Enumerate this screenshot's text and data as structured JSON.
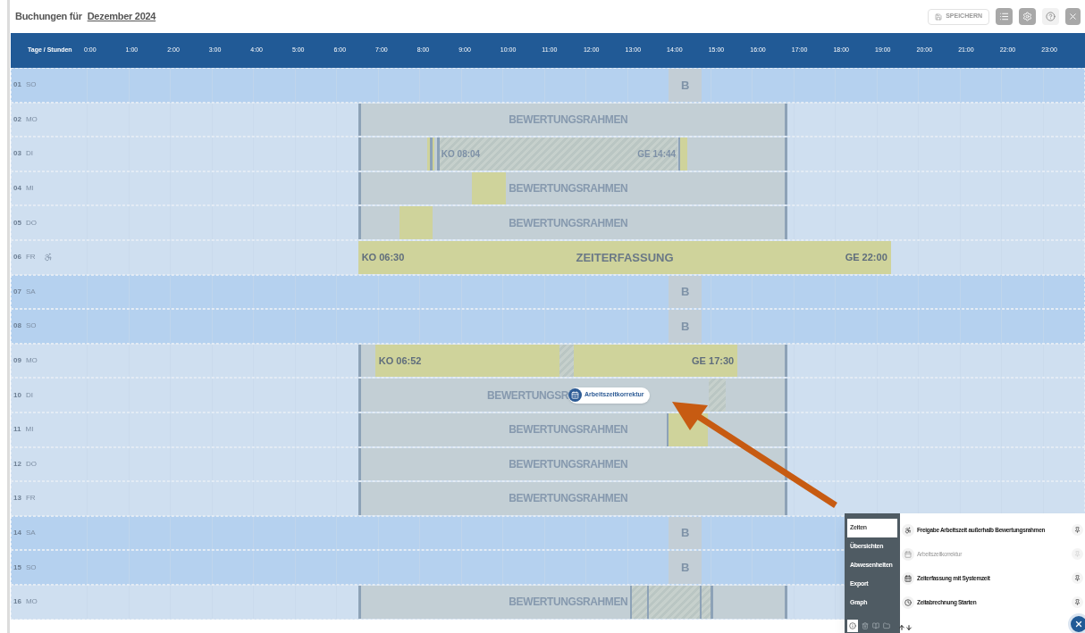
{
  "title": {
    "prefix": "Buchungen für",
    "month": "Dezember 2024"
  },
  "toolbar": {
    "save": "SPEICHERN"
  },
  "grid": {
    "corner": "Tage / Stunden",
    "hours": [
      "0:00",
      "1:00",
      "2:00",
      "3:00",
      "4:00",
      "5:00",
      "6:00",
      "7:00",
      "8:00",
      "9:00",
      "10:00",
      "11:00",
      "12:00",
      "13:00",
      "14:00",
      "15:00",
      "16:00",
      "17:00",
      "18:00",
      "19:00",
      "20:00",
      "21:00",
      "22:00",
      "23:00"
    ],
    "days": [
      {
        "day": "01",
        "weekday": "SO",
        "weekend": true,
        "released": false,
        "frame": false,
        "blocks": [
          {
            "kind": "absence",
            "text": "B"
          }
        ]
      },
      {
        "day": "02",
        "weekday": "MO",
        "weekend": false,
        "released": false,
        "frame": true,
        "frame_label": "BEWERTUNGSRAHMEN"
      },
      {
        "day": "03",
        "weekday": "DI",
        "weekend": false,
        "released": false,
        "frame": true,
        "blocks": [
          {
            "kind": "booking"
          },
          {
            "kind": "marker"
          },
          {
            "kind": "marker"
          },
          {
            "kind": "hatched",
            "start_text": "KO 08:04",
            "end_text": "GE 14:44"
          },
          {
            "kind": "marker"
          },
          {
            "kind": "booking"
          }
        ]
      },
      {
        "day": "04",
        "weekday": "MI",
        "weekend": false,
        "released": false,
        "frame": true,
        "frame_label": "BEWERTUNGSRAHMEN",
        "blocks": [
          {
            "kind": "booking"
          }
        ]
      },
      {
        "day": "05",
        "weekday": "DO",
        "weekend": false,
        "released": false,
        "frame": true,
        "frame_label": "BEWERTUNGSRAHMEN",
        "blocks": [
          {
            "kind": "booking"
          }
        ]
      },
      {
        "day": "06",
        "weekday": "FR",
        "weekend": false,
        "released": true,
        "frame": false,
        "blocks": [
          {
            "kind": "booking",
            "start_text": "KO 06:30",
            "center_text": "ZEITERFASSUNG",
            "end_text": "GE 22:00"
          }
        ]
      },
      {
        "day": "07",
        "weekday": "SA",
        "weekend": true,
        "released": false,
        "frame": false,
        "blocks": [
          {
            "kind": "absence",
            "text": "B"
          }
        ]
      },
      {
        "day": "08",
        "weekday": "SO",
        "weekend": true,
        "released": false,
        "frame": false,
        "blocks": [
          {
            "kind": "absence",
            "text": "B"
          }
        ]
      },
      {
        "day": "09",
        "weekday": "MO",
        "weekend": false,
        "released": false,
        "frame": true,
        "blocks": [
          {
            "kind": "booking",
            "start_text": "KO 06:52",
            "end_text": "GE 17:30"
          },
          {
            "kind": "hatched"
          }
        ]
      },
      {
        "day": "10",
        "weekday": "DI",
        "weekend": false,
        "released": false,
        "frame": true,
        "frame_label": "BEWERTUNGSR",
        "tooltip": "Arbeitszeitkorrektur",
        "blocks": [
          {
            "kind": "hatched"
          }
        ]
      },
      {
        "day": "11",
        "weekday": "MI",
        "weekend": false,
        "released": false,
        "frame": true,
        "frame_label": "BEWERTUNGSRAHMEN",
        "blocks": [
          {
            "kind": "marker"
          },
          {
            "kind": "booking"
          }
        ]
      },
      {
        "day": "12",
        "weekday": "DO",
        "weekend": false,
        "released": false,
        "frame": true,
        "frame_label": "BEWERTUNGSRAHMEN"
      },
      {
        "day": "13",
        "weekday": "FR",
        "weekend": false,
        "released": false,
        "frame": true,
        "frame_label": "BEWERTUNGSRAHMEN"
      },
      {
        "day": "14",
        "weekday": "SA",
        "weekend": true,
        "released": false,
        "frame": false,
        "blocks": [
          {
            "kind": "absence",
            "text": "B"
          }
        ]
      },
      {
        "day": "15",
        "weekday": "SO",
        "weekend": true,
        "released": false,
        "frame": false,
        "blocks": [
          {
            "kind": "absence",
            "text": "B"
          }
        ]
      },
      {
        "day": "16",
        "weekday": "MO",
        "weekend": false,
        "released": false,
        "frame": true,
        "frame_label": "BEWERTUNGSRAHMEN",
        "blocks": [
          {
            "kind": "marker"
          },
          {
            "kind": "hatched"
          },
          {
            "kind": "marker"
          },
          {
            "kind": "hatched"
          },
          {
            "kind": "marker"
          },
          {
            "kind": "hatched"
          },
          {
            "kind": "marker"
          }
        ]
      }
    ]
  },
  "panel": {
    "tabs": [
      {
        "label": "Zeiten",
        "selected": true
      },
      {
        "label": "Übersichten",
        "selected": false
      },
      {
        "label": "Abwesenheiten",
        "selected": false
      },
      {
        "label": "Export",
        "selected": false
      },
      {
        "label": "Graph",
        "selected": false
      }
    ],
    "actions": [
      {
        "kind": "release",
        "text": "Freigabe Arbeitszeit außerhalb Bewertungsrahmen",
        "disabled": false
      },
      {
        "kind": "correction",
        "text": "Arbeitszeitkorrektur",
        "disabled": true
      },
      {
        "kind": "capture",
        "text": "Zeiterfassung mit Systemzeit",
        "disabled": false
      },
      {
        "kind": "billing",
        "text": "Zeitabrechnung Starten",
        "disabled": false
      }
    ]
  }
}
